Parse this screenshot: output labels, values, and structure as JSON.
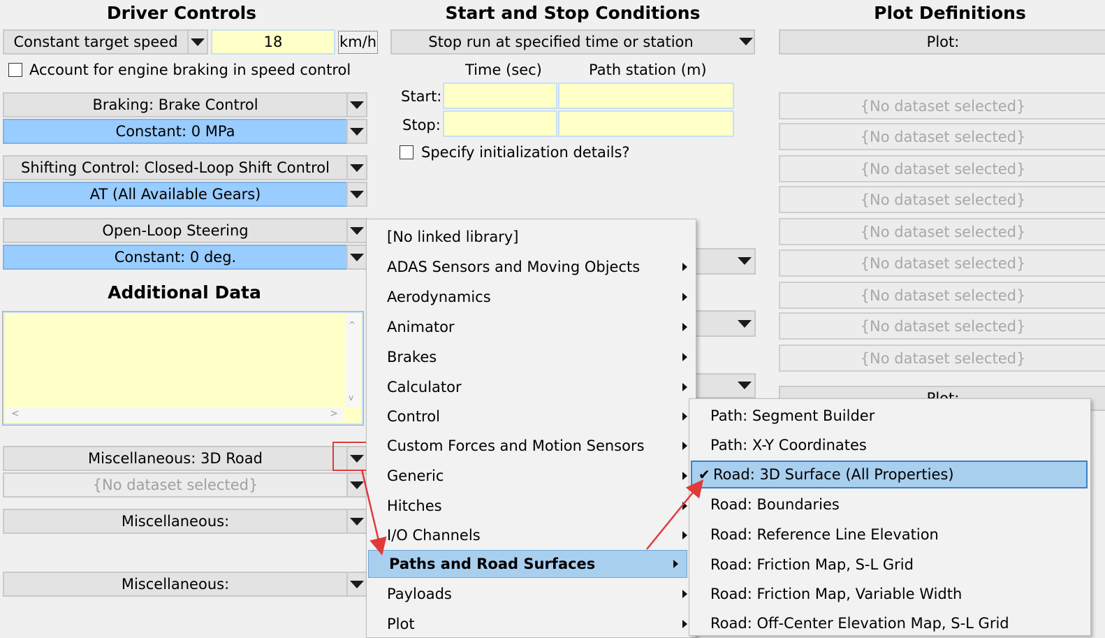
{
  "driver": {
    "title": "Driver Controls",
    "speed_mode": "Constant target speed",
    "speed_value": "18",
    "speed_unit": "km/h",
    "engine_braking_label": "Account for engine braking in speed control",
    "braking": "Braking: Brake Control",
    "braking_value": "Constant: 0 MPa",
    "shifting": "Shifting Control: Closed-Loop Shift Control",
    "shifting_value": "AT (All Available Gears)",
    "steering": "Open-Loop Steering",
    "steering_value": "Constant: 0 deg."
  },
  "additional": {
    "title": "Additional Data",
    "misc1": "Miscellaneous: 3D Road",
    "misc1_value": "{No dataset selected}",
    "misc2": "Miscellaneous:",
    "misc3": "Miscellaneous:"
  },
  "conditions": {
    "title": "Start and Stop Conditions",
    "stop_mode": "Stop run at specified time or station",
    "time_header": "Time (sec)",
    "station_header": "Path station (m)",
    "start_label": "Start:",
    "stop_label": "Stop:",
    "init_label": "Specify initialization details?"
  },
  "plots": {
    "title": "Plot Definitions",
    "plot_button": "Plot:",
    "items": [
      "{No dataset selected}",
      "{No dataset selected}",
      "{No dataset selected}",
      "{No dataset selected}",
      "{No dataset selected}",
      "{No dataset selected}",
      "{No dataset selected}",
      "{No dataset selected}",
      "{No dataset selected}"
    ],
    "partial_button": "Plot:"
  },
  "menu": {
    "items": [
      {
        "label": "[No linked library]"
      },
      {
        "label": "ADAS Sensors and Moving Objects"
      },
      {
        "label": "Aerodynamics"
      },
      {
        "label": "Animator"
      },
      {
        "label": "Brakes"
      },
      {
        "label": "Calculator"
      },
      {
        "label": "Control"
      },
      {
        "label": "Custom Forces and Motion Sensors"
      },
      {
        "label": "Generic"
      },
      {
        "label": "Hitches"
      },
      {
        "label": "I/O Channels"
      },
      {
        "label": "Paths and Road Surfaces"
      },
      {
        "label": "Payloads"
      },
      {
        "label": "Plot"
      }
    ]
  },
  "submenu": {
    "items": [
      {
        "label": "Path: Segment Builder"
      },
      {
        "label": "Path: X-Y Coordinates"
      },
      {
        "label": "Road: 3D Surface (All Properties)"
      },
      {
        "label": "Road: Boundaries"
      },
      {
        "label": "Road: Reference Line Elevation"
      },
      {
        "label": "Road: Friction Map, S-L Grid"
      },
      {
        "label": "Road: Friction Map, Variable Width"
      },
      {
        "label": "Road: Off-Center Elevation Map, S-L Grid"
      }
    ],
    "check_mark": "✔"
  },
  "colors": {
    "field_yellow": "#ffffc8",
    "selection_blue": "#99ccff",
    "menu_highlight": "#a9cfef",
    "annotation_red": "#e03a3a"
  }
}
